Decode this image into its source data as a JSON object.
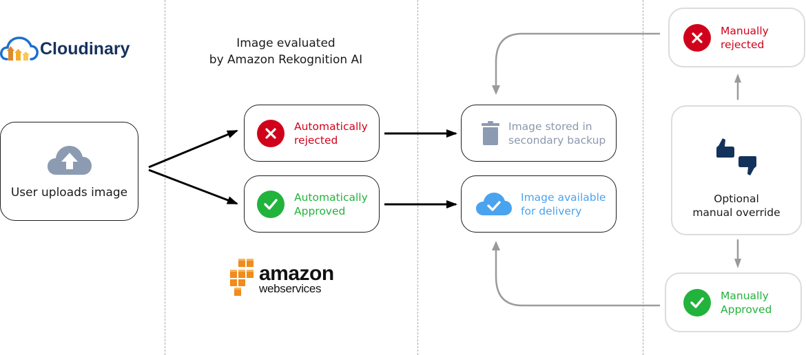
{
  "brand": {
    "cloudinary": "Cloudinary",
    "aws_line1": "amazon",
    "aws_line2": "webservices"
  },
  "columns": {
    "evaluation_title_line1": "Image evaluated",
    "evaluation_title_line2": "by Amazon Rekognition AI"
  },
  "nodes": {
    "upload": {
      "label": "User uploads image",
      "icon": "cloud-upload-icon"
    },
    "auto_rejected": {
      "line1": "Automatically",
      "line2": "rejected",
      "icon": "x-circle-icon",
      "color": "#d0021b"
    },
    "auto_approved": {
      "line1": "Automatically",
      "line2": "Approved",
      "icon": "check-circle-icon",
      "color": "#22b33c"
    },
    "backup": {
      "line1": "Image stored in",
      "line2": "secondary backup",
      "icon": "trash-icon",
      "color": "#8a98ad"
    },
    "delivery": {
      "line1": "Image available",
      "line2": "for delivery",
      "icon": "cloud-check-icon",
      "color": "#4aa3ee"
    },
    "manual_rejected": {
      "line1": "Manually",
      "line2": "rejected",
      "icon": "x-circle-icon",
      "color": "#d0021b"
    },
    "override": {
      "line1": "Optional",
      "line2": "manual override",
      "icon": "thumbs-up-down-icon",
      "color": "#13325b"
    },
    "manual_approved": {
      "line1": "Manually",
      "line2": "Approved",
      "icon": "check-circle-icon",
      "color": "#22b33c"
    }
  }
}
